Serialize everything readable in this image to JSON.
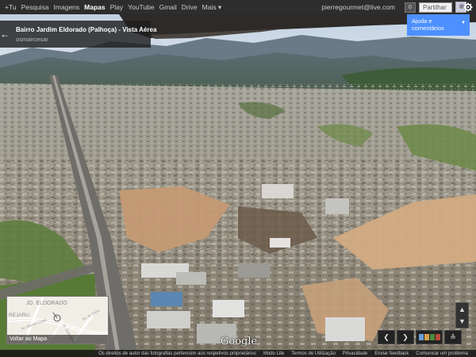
{
  "gbar": {
    "nav": [
      "+Tu",
      "Pesquisa",
      "Imagens",
      "Mapas",
      "Play",
      "YouTube",
      "Gmail",
      "Drive",
      "Mais ▾"
    ],
    "active": "Mapas",
    "email": "pierregourmet@live.com",
    "notification_count": "0",
    "share_label": "Partilhar"
  },
  "title_panel": {
    "title": "Bairro Jardim Eldorado (Palhoça) - Vista Aérea",
    "author": "osmaircesar"
  },
  "help": {
    "label_line1": "Ajuda e",
    "label_line2": "comentários"
  },
  "minimap": {
    "place_label": "JD. ELDORADO",
    "place_label2": "REJARU",
    "street1": "Av. Alteres Costa",
    "street2": "R. José Silva",
    "street3": "Av. do Beira",
    "back_label": "Voltar ao Mapa"
  },
  "logo": "Google",
  "footer": {
    "copyright": "Os direitos de autor das fotografias pertencem aos respetivos proprietários",
    "links": [
      "Modo Lite",
      "Termos de Utilização",
      "Privacidade",
      "Enviar feedback",
      "Comunicar um problema"
    ]
  },
  "icons": {
    "back": "back-arrow-icon",
    "gear": "gear-icon",
    "prev": "chevron-left-icon",
    "next": "chevron-right-icon",
    "expand": "expand-icon"
  },
  "colors": {
    "accent": "#4d90fe",
    "bar": "#2d2d2d"
  }
}
